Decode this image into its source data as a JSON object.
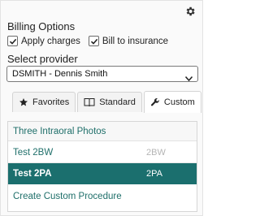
{
  "billing": {
    "title": "Billing Options",
    "apply_charges_label": "Apply charges",
    "apply_charges_checked": true,
    "bill_insurance_label": "Bill to insurance",
    "bill_insurance_checked": true
  },
  "provider": {
    "title": "Select provider",
    "selected": "DSMITH - Dennis Smith"
  },
  "tabs": [
    {
      "label": "Favorites",
      "icon": "star-icon",
      "active": false
    },
    {
      "label": "Standard",
      "icon": "book-icon",
      "active": false
    },
    {
      "label": "Custom",
      "icon": "wrench-icon",
      "active": true
    }
  ],
  "list": {
    "group_header": "Three Intraoral Photos",
    "items": [
      {
        "name": "Test 2BW",
        "code": "2BW",
        "selected": false
      },
      {
        "name": "Test 2PA",
        "code": "2PA",
        "selected": true
      }
    ],
    "create_label": "Create Custom Procedure"
  },
  "colors": {
    "accent": "#1b6f6e",
    "link": "#1f6f6a"
  }
}
